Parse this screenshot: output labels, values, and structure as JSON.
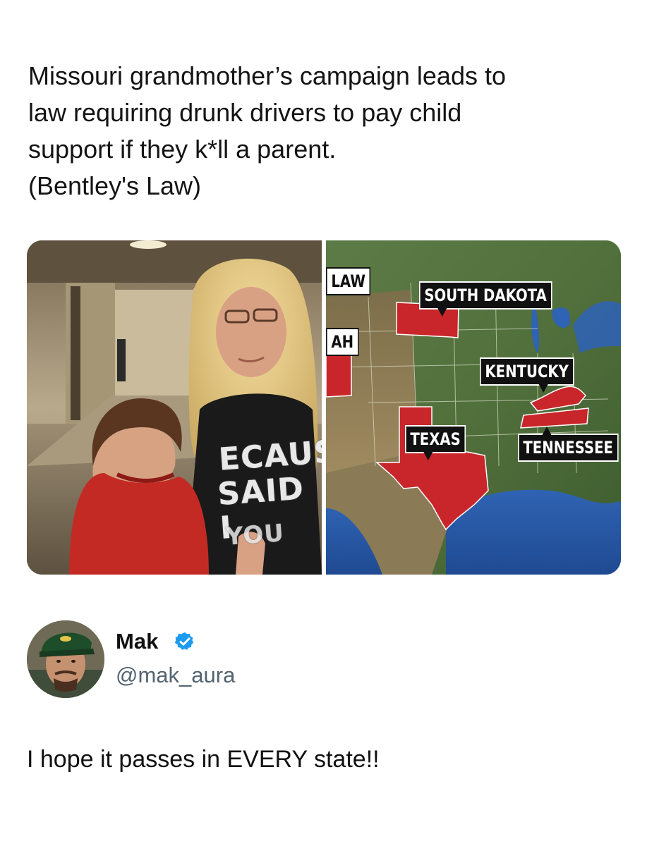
{
  "headline": {
    "lines": [
      "Missouri grandmother’s campaign leads to",
      "law requiring drunk drivers to pay child",
      "support if they k*ll a parent.",
      "(Bentley's Law)"
    ]
  },
  "media": {
    "left_photo": {
      "shirt_text": [
        "ECAUS",
        "SAID I",
        "YOU"
      ]
    },
    "right_photo": {
      "labels": {
        "law": "LAW",
        "utah": "AH",
        "south_dakota": "SOUTH DAKOTA",
        "kentucky": "KENTUCKY",
        "texas": "TEXAS",
        "tennessee": "TENNESSEE"
      },
      "colors": {
        "highlight_state": "#c8262a",
        "land": "#4f6b3a",
        "ocean": "#2a58a8"
      }
    }
  },
  "author": {
    "name": "Mak",
    "handle": "@mak_aura",
    "verified_color": "#1d9bf0",
    "avatar_icon": "profile-photo"
  },
  "tweet": {
    "text": "I hope it passes in EVERY state!!"
  }
}
